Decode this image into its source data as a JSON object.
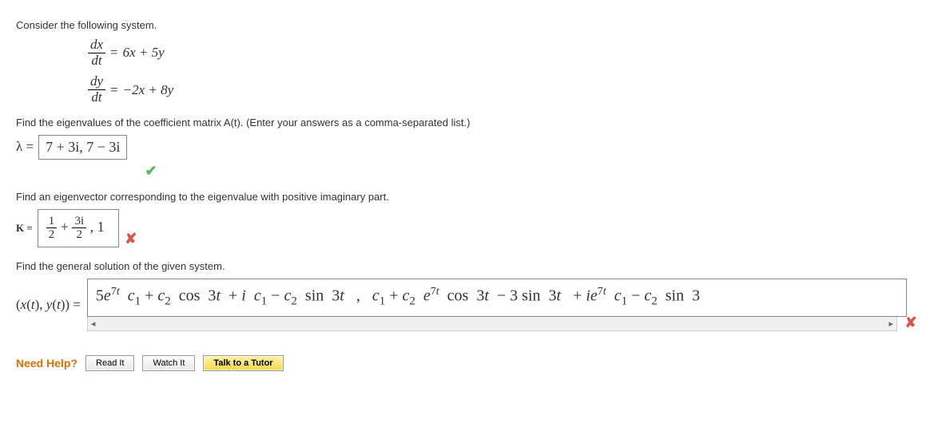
{
  "prompt_intro": "Consider the following system.",
  "equations": {
    "eq1_lhs_num": "dx",
    "eq1_lhs_den": "dt",
    "eq1_rhs": "6x + 5y",
    "eq2_lhs_num": "dy",
    "eq2_lhs_den": "dt",
    "eq2_rhs": "−2x + 8y"
  },
  "eigenvalue_prompt": "Find the eigenvalues of the coefficient matrix A(t). (Enter your answers as a comma-separated list.)",
  "lambda_label": "λ =",
  "lambda_answer": "7 + 3i, 7 − 3i",
  "eigenvector_prompt": "Find an eigenvector corresponding to the eigenvalue with positive imaginary part.",
  "k_label": "K =",
  "k_answer_frac1_num": "1",
  "k_answer_frac1_den": "2",
  "k_answer_plus": " + ",
  "k_answer_frac2_num": "3i",
  "k_answer_frac2_den": "2",
  "k_answer_rest": ", 1",
  "general_prompt": "Find the general solution of the given system.",
  "sol_label": "(x(t), y(t)) =",
  "sol_content": "5e7t  c1 + c2  cos  3t  + i  c1 − c2  sin  3t   ,   c1 + c2  e7t  cos  3t  − 3 sin  3t   + ie7t  c1 − c2  sin  3",
  "need_help": "Need Help?",
  "buttons": {
    "read": "Read It",
    "watch": "Watch It",
    "talk": "Talk to a Tutor"
  }
}
